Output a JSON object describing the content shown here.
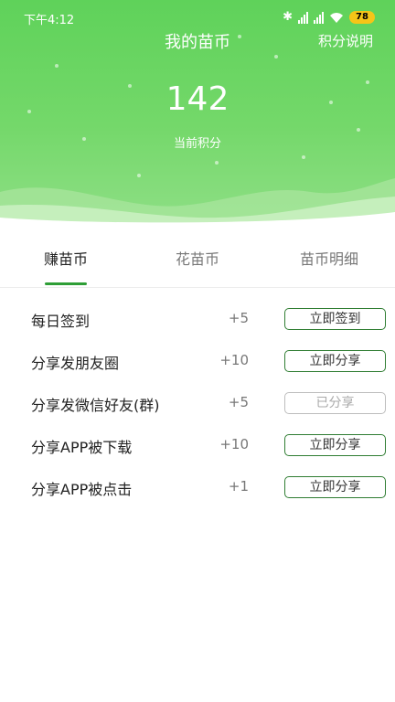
{
  "status_bar": {
    "time": "下午4:12",
    "battery": "78"
  },
  "header": {
    "title": "我的苗币",
    "rules_link": "积分说明",
    "points": "142",
    "points_label": "当前积分"
  },
  "tabs": [
    {
      "label": "赚苗币",
      "active": true
    },
    {
      "label": "花苗币",
      "active": false
    },
    {
      "label": "苗币明细",
      "active": false
    }
  ],
  "tasks": [
    {
      "name": "每日签到",
      "points": "+5",
      "button": "立即签到",
      "done": false
    },
    {
      "name": "分享发朋友圈",
      "points": "+10",
      "button": "立即分享",
      "done": false
    },
    {
      "name": "分享发微信好友(群)",
      "points": "+5",
      "button": "已分享",
      "done": true
    },
    {
      "name": "分享APP被下载",
      "points": "+10",
      "button": "立即分享",
      "done": false
    },
    {
      "name": "分享APP被点击",
      "points": "+1",
      "button": "立即分享",
      "done": false
    }
  ],
  "colors": {
    "header_green": "#5fd25a",
    "accent_green": "#2e9e36",
    "button_border": "#2f7d32"
  }
}
